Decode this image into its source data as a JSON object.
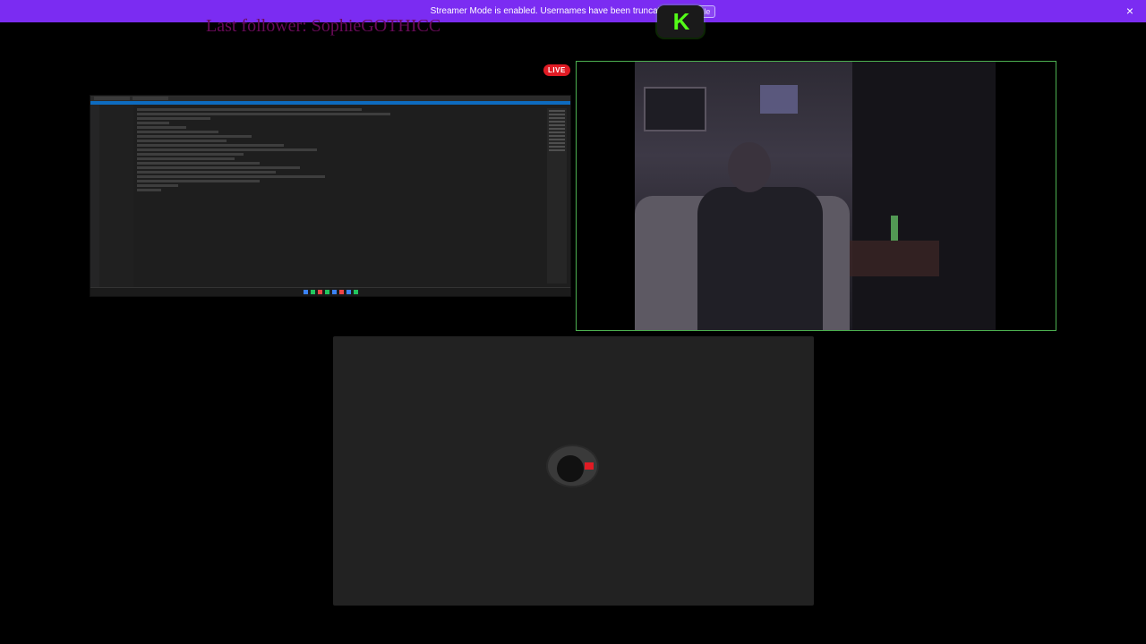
{
  "banner": {
    "message": "Streamer Mode is enabled. Usernames have been truncated.",
    "action_label": "Disable",
    "close_icon": "×"
  },
  "overlay": {
    "last_follower_text": "Last follower: SophieGOTHICC",
    "live_badge": "LIVE",
    "brand_logo_text": "K"
  },
  "colors": {
    "banner": "#7b2cf2",
    "live": "#e01b24",
    "webcam_border": "#4caf50",
    "brand_green": "#53fc18",
    "tile_bg": "#222222"
  },
  "icons": {
    "close": "close-icon",
    "brand": "brand-logo-icon"
  }
}
